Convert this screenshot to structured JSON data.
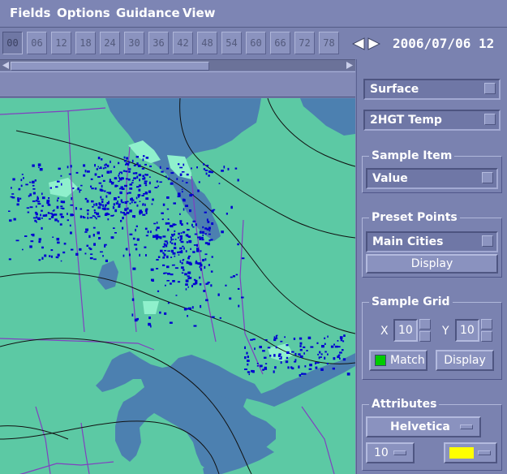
{
  "menu": [
    "Fields",
    "Options",
    "Guidance",
    "View"
  ],
  "hours": [
    "00",
    "06",
    "12",
    "18",
    "24",
    "30",
    "36",
    "42",
    "48",
    "54",
    "60",
    "66",
    "72",
    "78"
  ],
  "active_hour_index": 0,
  "datetime": "2006/07/06 12",
  "panel": {
    "level": "Surface",
    "field": "2HGT Temp",
    "sample_item": {
      "title": "Sample Item",
      "value": "Value"
    },
    "preset_points": {
      "title": "Preset Points",
      "value": "Main Cities",
      "display": "Display"
    },
    "sample_grid": {
      "title": "Sample Grid",
      "x_label": "X",
      "x_value": "10",
      "y_label": "Y",
      "y_value": "10",
      "match": "Match",
      "display": "Display"
    },
    "attributes": {
      "title": "Attributes",
      "font": "Helvetica",
      "size": "10",
      "color": "#ffff00"
    }
  },
  "colors": {
    "land": "#5cc9a4",
    "water": "#4c80b0",
    "highlight": "#8ff0cc",
    "stations": "#0000d0",
    "contours": "#111111",
    "borders": "#8040c0",
    "match_indicator": "#00cc00"
  }
}
